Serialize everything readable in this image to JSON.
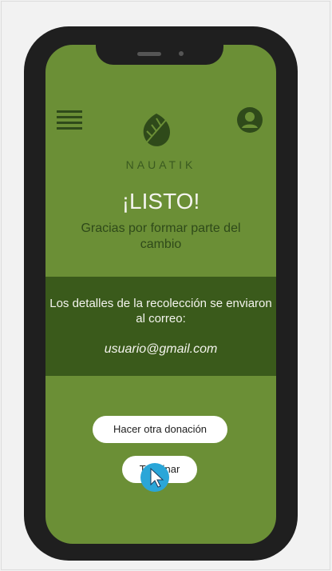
{
  "brand": "NAUATIK",
  "title": "¡LISTO!",
  "subtitle": "Gracias por formar parte del cambio",
  "details": "Los detalles de la recolección se enviaron al correo:",
  "email": "usuario@gmail.com",
  "buttons": {
    "donate": "Hacer otra donación",
    "finish": "Terminar"
  },
  "colors": {
    "screen": "#6b8f36",
    "band": "#3a5a1b",
    "accent": "#2f4a1a"
  },
  "icons": [
    "menu-icon",
    "user-icon",
    "leaf-icon",
    "cursor-icon"
  ]
}
